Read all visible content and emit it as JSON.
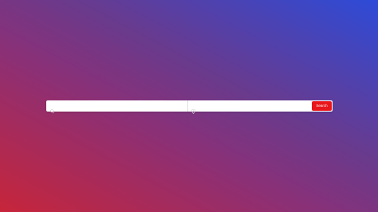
{
  "search": {
    "keyword_placeholder": "",
    "location_placeholder": "",
    "button_label": "Search"
  },
  "colors": {
    "button": "#e8161b",
    "gradient_start": "#c7253a",
    "gradient_end": "#2d4bd8"
  },
  "icons": {
    "keyword": "search-icon",
    "location": "map-pin-icon"
  }
}
